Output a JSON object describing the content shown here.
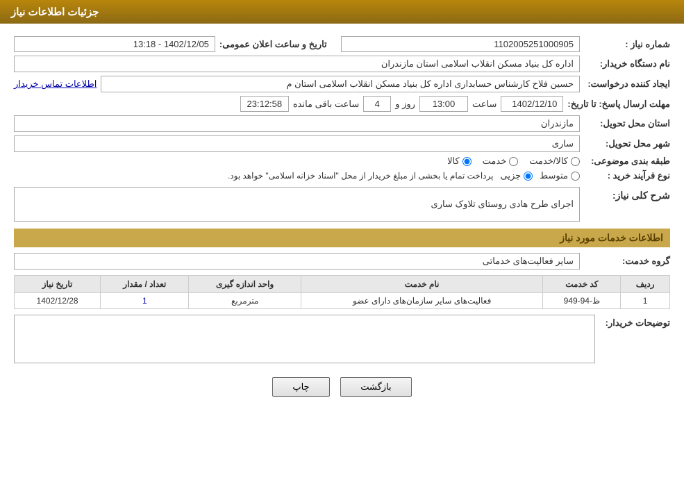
{
  "header": {
    "title": "جزئیات اطلاعات نیاز"
  },
  "fields": {
    "need_number_label": "شماره نیاز :",
    "need_number_value": "1102005251000905",
    "buyer_org_label": "نام دستگاه خریدار:",
    "buyer_org_value": "اداره کل بنیاد مسکن انقلاب اسلامی استان مازندران",
    "creator_label": "ایجاد کننده درخواست:",
    "creator_value": "حسین فلاح کارشناس حسابداری اداره کل بنیاد مسکن انقلاب اسلامی استان م",
    "contact_link": "اطلاعات تماس خریدار",
    "response_date_label": "مهلت ارسال پاسخ: تا تاریخ:",
    "response_date": "1402/12/10",
    "response_time_label": "ساعت",
    "response_time": "13:00",
    "response_day_label": "روز و",
    "response_days": "4",
    "response_remaining_label": "ساعت باقی مانده",
    "response_remaining": "23:12:58",
    "delivery_province_label": "استان محل تحویل:",
    "delivery_province_value": "مازندران",
    "delivery_city_label": "شهر محل تحویل:",
    "delivery_city_value": "ساری",
    "category_label": "طبقه بندی موضوعی:",
    "category_kala": "کالا",
    "category_khedmat": "خدمت",
    "category_kala_khedmat": "کالا/خدمت",
    "process_type_label": "نوع فرآیند خرید :",
    "process_jozvi": "جزیی",
    "process_mottaveset": "متوسط",
    "process_description": "پرداخت تمام یا بخشی از مبلغ خریدار از محل \"اسناد خزانه اسلامی\" خواهد بود.",
    "announcement_label": "تاریخ و ساعت اعلان عمومی:",
    "announcement_value": "1402/12/05 - 13:18",
    "general_description_title": "شرح کلی نیاز:",
    "general_description_value": "اجرای طرح هادی روستای تلاوک ساری",
    "services_section_title": "اطلاعات خدمات مورد نیاز",
    "service_group_label": "گروه خدمت:",
    "service_group_value": "سایر فعالیت‌های خدماتی",
    "table_headers": {
      "row_number": "ردیف",
      "service_code": "کد خدمت",
      "service_name": "نام خدمت",
      "measurement_unit": "واحد اندازه گیری",
      "quantity": "تعداد / مقدار",
      "need_date": "تاریخ نیاز"
    },
    "table_rows": [
      {
        "row_number": "1",
        "service_code": "ظ-94-949",
        "service_name": "فعالیت‌های سایر سازمان‌های دارای عضو",
        "measurement_unit": "مترمربع",
        "quantity": "1",
        "need_date": "1402/12/28"
      }
    ],
    "buyer_notes_label": "توضیحات خریدار:",
    "buyer_notes_value": ""
  },
  "buttons": {
    "print": "چاپ",
    "back": "بازگشت"
  }
}
